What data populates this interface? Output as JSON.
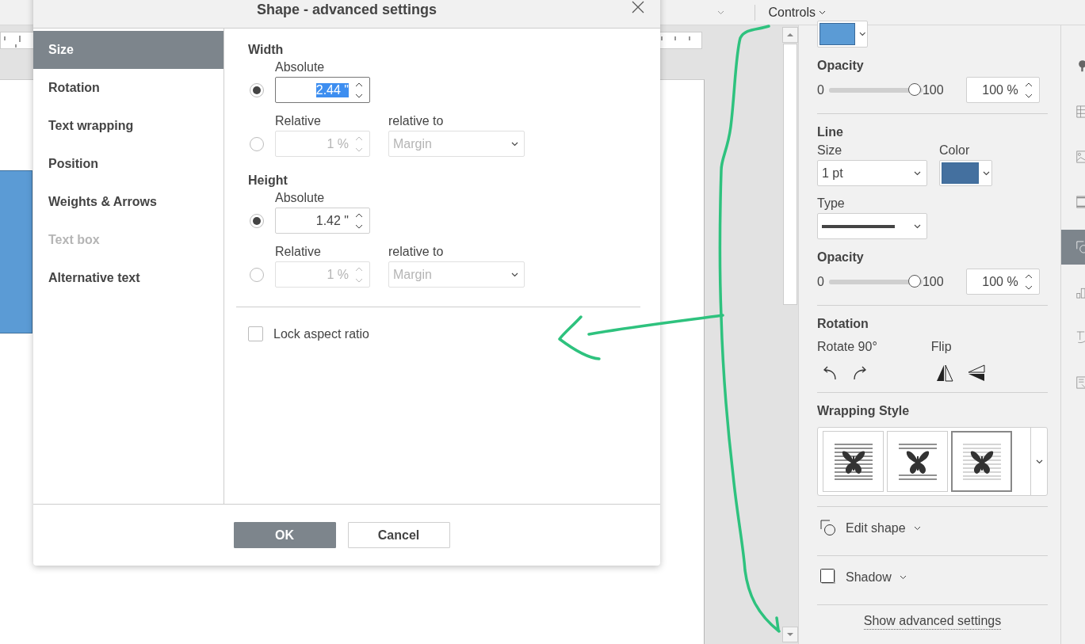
{
  "toolbar": {
    "controls_menu": "Controls"
  },
  "dialog": {
    "title": "Shape - advanced settings",
    "tabs": [
      {
        "label": "Size",
        "selected": true,
        "disabled": false
      },
      {
        "label": "Rotation",
        "selected": false,
        "disabled": false
      },
      {
        "label": "Text wrapping",
        "selected": false,
        "disabled": false
      },
      {
        "label": "Position",
        "selected": false,
        "disabled": false
      },
      {
        "label": "Weights & Arrows",
        "selected": false,
        "disabled": false
      },
      {
        "label": "Text box",
        "selected": false,
        "disabled": true
      },
      {
        "label": "Alternative text",
        "selected": false,
        "disabled": false
      }
    ],
    "sections": [
      {
        "heading": "Width",
        "absolute": {
          "label": "Absolute",
          "selected": true,
          "value": "2.44 \"",
          "text_selected": true
        },
        "relative": {
          "label": "Relative",
          "selected": false,
          "disabled": true,
          "value": "1 %"
        },
        "relative_to": {
          "label": "relative to",
          "value": "Margin",
          "disabled": true
        }
      },
      {
        "heading": "Height",
        "absolute": {
          "label": "Absolute",
          "selected": true,
          "value": "1.42 \"",
          "text_selected": false
        },
        "relative": {
          "label": "Relative",
          "selected": false,
          "disabled": true,
          "value": "1 %"
        },
        "relative_to": {
          "label": "relative to",
          "value": "Margin",
          "disabled": true
        }
      }
    ],
    "lock_aspect_ratio": {
      "label": "Lock aspect ratio",
      "checked": false
    },
    "buttons": [
      {
        "label": "OK",
        "kind": "primary"
      },
      {
        "label": "Cancel",
        "kind": "secondary"
      }
    ]
  },
  "panel": {
    "fill": {
      "color": "#5b9bd5"
    },
    "fill_opacity": {
      "heading": "Opacity",
      "min": "0",
      "max": "100",
      "level": 1,
      "value": "100 %"
    },
    "line": {
      "heading": "Line",
      "size_label": "Size",
      "size_value": "1 pt",
      "color_label": "Color",
      "color": "#44709f",
      "type_label": "Type"
    },
    "line_opacity": {
      "heading": "Opacity",
      "min": "0",
      "max": "100",
      "level": 1,
      "value": "100 %"
    },
    "rotation": {
      "heading": "Rotation",
      "rotate_label": "Rotate 90°",
      "flip_label": "Flip"
    },
    "wrapping": {
      "heading": "Wrapping Style",
      "options": [
        {
          "kind": "square",
          "selected": false
        },
        {
          "kind": "top_bottom",
          "selected": false
        },
        {
          "kind": "behind",
          "selected": true
        }
      ]
    },
    "edit_shape": "Edit shape",
    "shadow": "Shadow",
    "advanced_link": "Show advanced settings"
  },
  "side_tabs": [
    {
      "kind": "paragraph",
      "selected": false
    },
    {
      "kind": "table",
      "selected": false
    },
    {
      "kind": "image",
      "selected": false
    },
    {
      "kind": "header",
      "selected": false
    },
    {
      "kind": "shape",
      "selected": true
    },
    {
      "kind": "chart",
      "selected": false
    },
    {
      "kind": "textart",
      "selected": false
    },
    {
      "kind": "form",
      "selected": false
    }
  ]
}
